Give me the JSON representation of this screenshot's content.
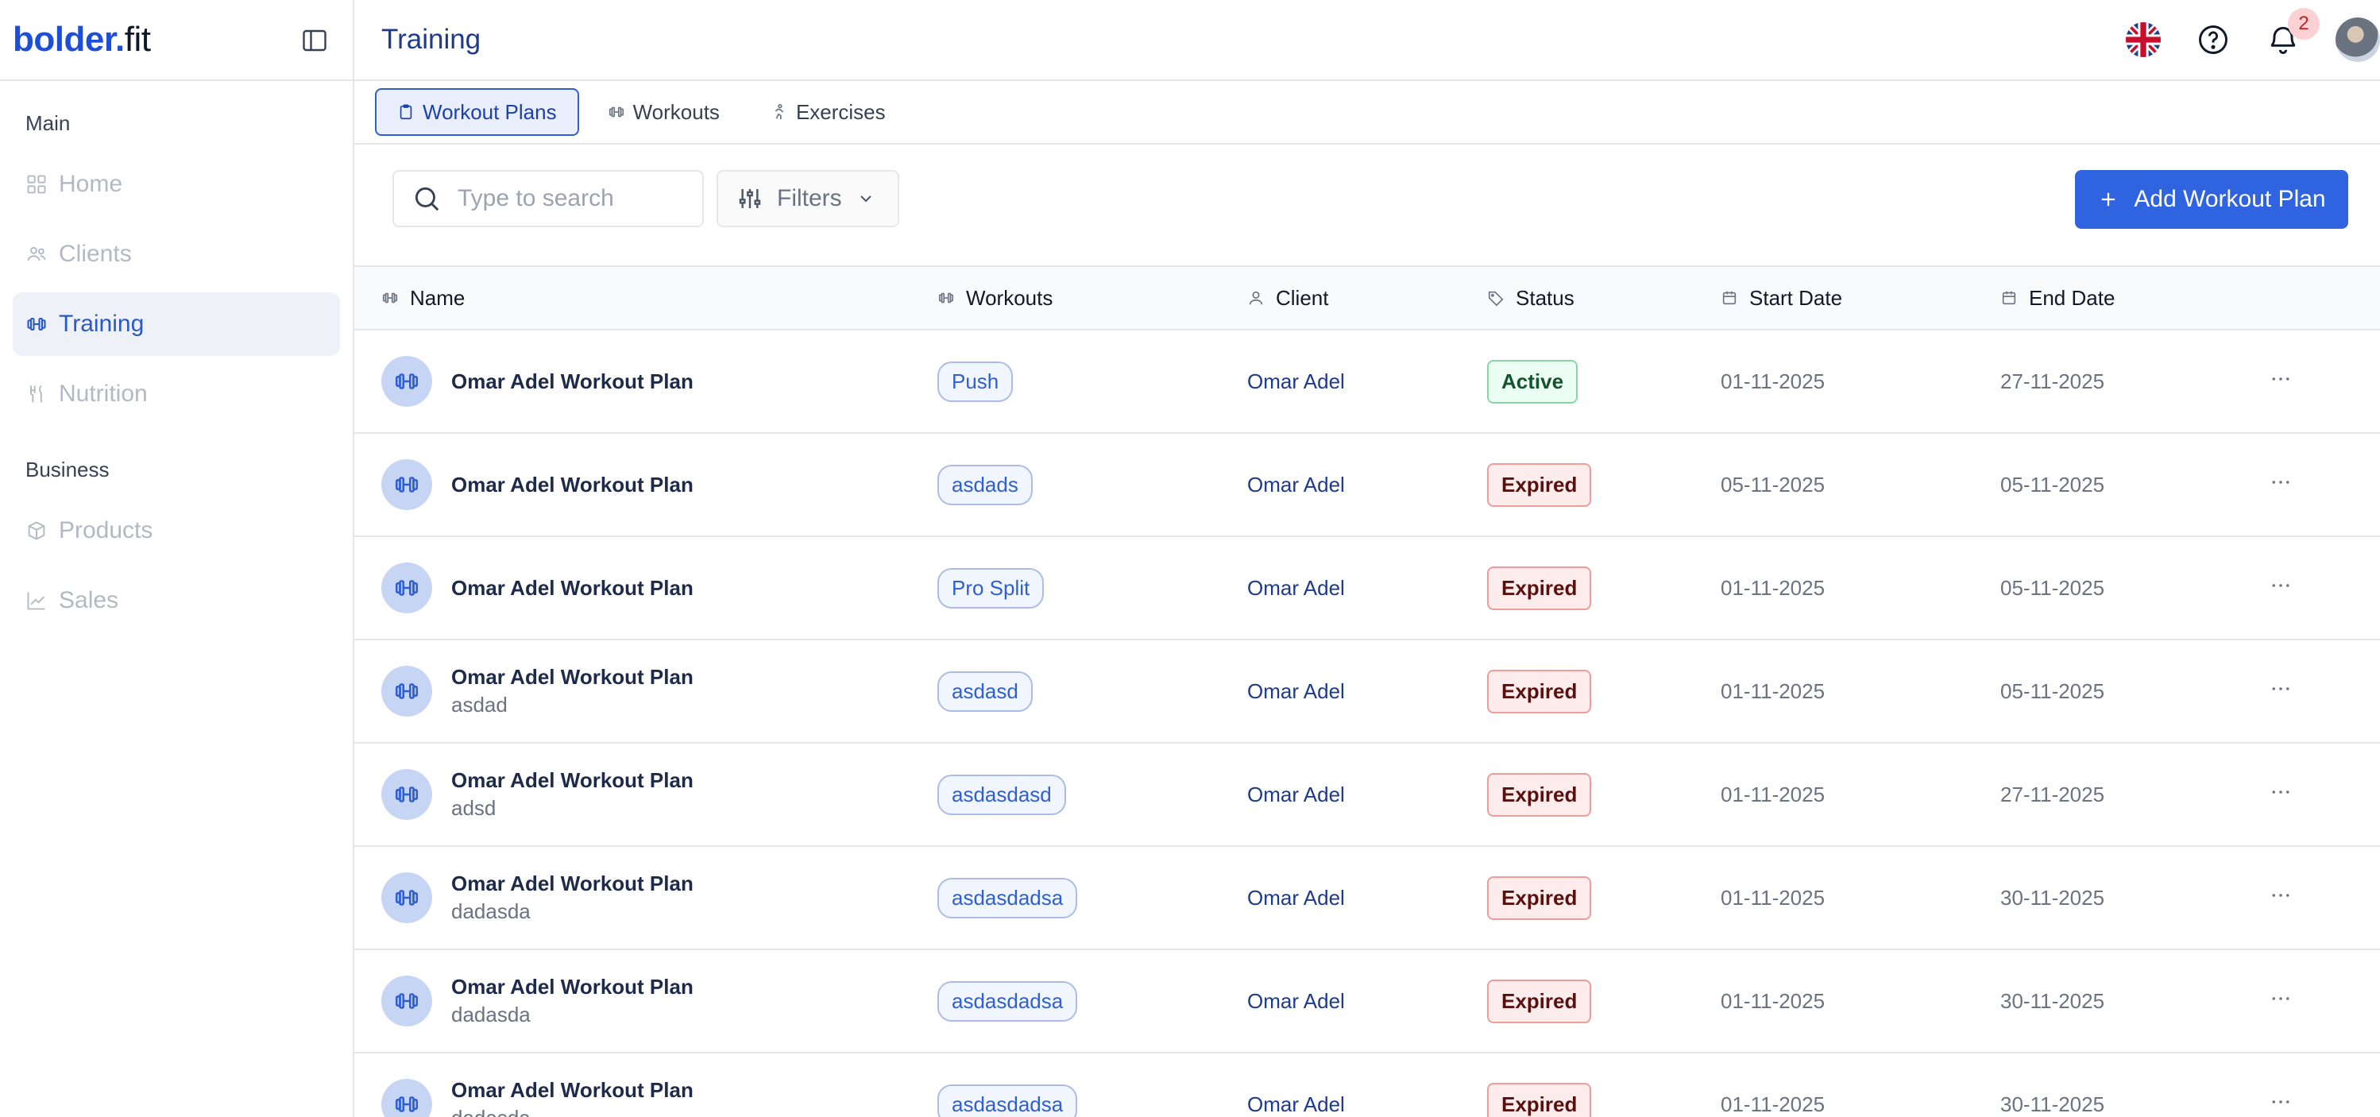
{
  "brand": {
    "name_bold": "bolder",
    "name_dot": ".",
    "name_rest": "fit"
  },
  "sidebar": {
    "sections": [
      {
        "title": "Main"
      },
      {
        "title": "Business"
      }
    ],
    "items": [
      {
        "label": "Home",
        "icon": "grid-icon"
      },
      {
        "label": "Clients",
        "icon": "users-icon"
      },
      {
        "label": "Training",
        "icon": "dumbbell-icon",
        "active": true
      },
      {
        "label": "Nutrition",
        "icon": "utensils-icon"
      },
      {
        "label": "Products",
        "icon": "box-icon"
      },
      {
        "label": "Sales",
        "icon": "chart-icon"
      }
    ]
  },
  "header": {
    "title": "Training",
    "notifications_count": "2"
  },
  "tabs": [
    {
      "label": "Workout Plans",
      "active": true
    },
    {
      "label": "Workouts"
    },
    {
      "label": "Exercises"
    }
  ],
  "toolbar": {
    "search_placeholder": "Type to search",
    "filters_label": "Filters",
    "add_label": "Add Workout Plan"
  },
  "table": {
    "columns": [
      "Name",
      "Workouts",
      "Client",
      "Status",
      "Start Date",
      "End Date"
    ],
    "rows": [
      {
        "name": "Omar Adel Workout Plan",
        "sub": "",
        "workout": "Push",
        "client": "Omar Adel",
        "status": "Active",
        "start": "01-11-2025",
        "end": "27-11-2025"
      },
      {
        "name": "Omar Adel Workout Plan",
        "sub": "",
        "workout": "asdads",
        "client": "Omar Adel",
        "status": "Expired",
        "start": "05-11-2025",
        "end": "05-11-2025"
      },
      {
        "name": "Omar Adel Workout Plan",
        "sub": "",
        "workout": "Pro Split",
        "client": "Omar Adel",
        "status": "Expired",
        "start": "01-11-2025",
        "end": "05-11-2025"
      },
      {
        "name": "Omar Adel Workout Plan",
        "sub": "asdad",
        "workout": "asdasd",
        "client": "Omar Adel",
        "status": "Expired",
        "start": "01-11-2025",
        "end": "05-11-2025"
      },
      {
        "name": "Omar Adel Workout Plan",
        "sub": "adsd",
        "workout": "asdasdasd",
        "client": "Omar Adel",
        "status": "Expired",
        "start": "01-11-2025",
        "end": "27-11-2025"
      },
      {
        "name": "Omar Adel Workout Plan",
        "sub": "dadasda",
        "workout": "asdasdadsa",
        "client": "Omar Adel",
        "status": "Expired",
        "start": "01-11-2025",
        "end": "30-11-2025"
      },
      {
        "name": "Omar Adel Workout Plan",
        "sub": "dadasda",
        "workout": "asdasdadsa",
        "client": "Omar Adel",
        "status": "Expired",
        "start": "01-11-2025",
        "end": "30-11-2025"
      },
      {
        "name": "Omar Adel Workout Plan",
        "sub": "dadasda",
        "workout": "asdasdadsa",
        "client": "Omar Adel",
        "status": "Expired",
        "start": "01-11-2025",
        "end": "30-11-2025"
      }
    ]
  },
  "colors": {
    "accent": "#2f63e0",
    "active_status": "#14532d",
    "expired_status": "#5b1010"
  }
}
